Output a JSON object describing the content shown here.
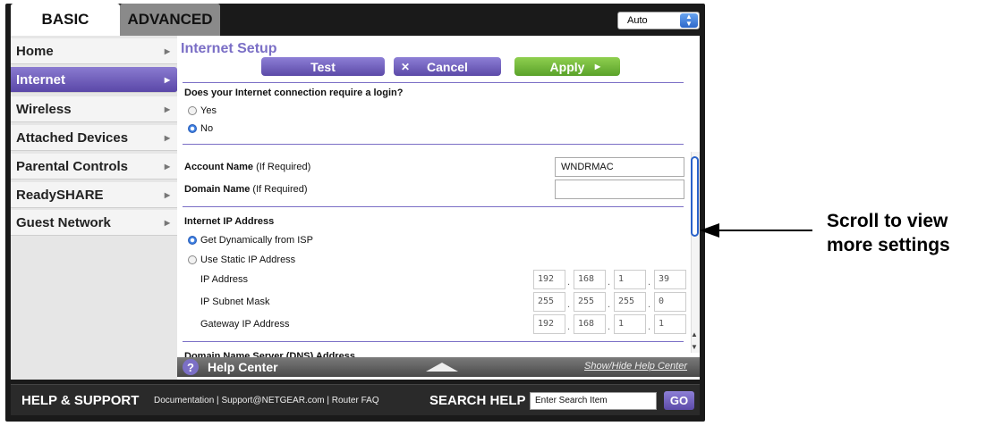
{
  "tabs": {
    "basic": "BASIC",
    "advanced": "ADVANCED"
  },
  "language_select": {
    "value": "Auto"
  },
  "sidebar": {
    "items": [
      {
        "label": "Home"
      },
      {
        "label": "Internet"
      },
      {
        "label": "Wireless"
      },
      {
        "label": "Attached Devices"
      },
      {
        "label": "Parental Controls"
      },
      {
        "label": "ReadySHARE"
      },
      {
        "label": "Guest Network"
      }
    ],
    "active": "Internet"
  },
  "main": {
    "title": "Internet Setup",
    "buttons": {
      "test": "Test",
      "cancel": "Cancel",
      "apply": "Apply"
    },
    "login_question": "Does your Internet connection require a login?",
    "login_options": {
      "yes": "Yes",
      "no": "No"
    },
    "login_selected": "No",
    "account_name_label": "Account Name",
    "account_name_hint": "(If Required)",
    "account_name_value": "WNDRMAC",
    "domain_name_label": "Domain Name",
    "domain_name_hint": "(If Required)",
    "domain_name_value": "",
    "ip_section_title": "Internet IP Address",
    "ip_options": {
      "dynamic": "Get Dynamically from ISP",
      "static": "Use Static IP Address"
    },
    "ip_selected": "Get Dynamically from ISP",
    "ip_address_label": "IP Address",
    "ip_address": [
      "192",
      "168",
      "1",
      "39"
    ],
    "subnet_label": "IP Subnet Mask",
    "subnet": [
      "255",
      "255",
      "255",
      "0"
    ],
    "gateway_label": "Gateway IP Address",
    "gateway": [
      "192",
      "168",
      "1",
      "1"
    ],
    "dns_section_title": "Domain Name Server (DNS) Address"
  },
  "help_bar": {
    "title": "Help Center",
    "toggle": "Show/Hide Help Center"
  },
  "support": {
    "title": "HELP & SUPPORT",
    "links": [
      "Documentation",
      "Support@NETGEAR.com",
      "Router FAQ"
    ],
    "search_title": "SEARCH HELP",
    "search_value": "Enter Search Item",
    "go": "GO"
  },
  "callout": {
    "line1": "Scroll to view",
    "line2": "more settings"
  }
}
